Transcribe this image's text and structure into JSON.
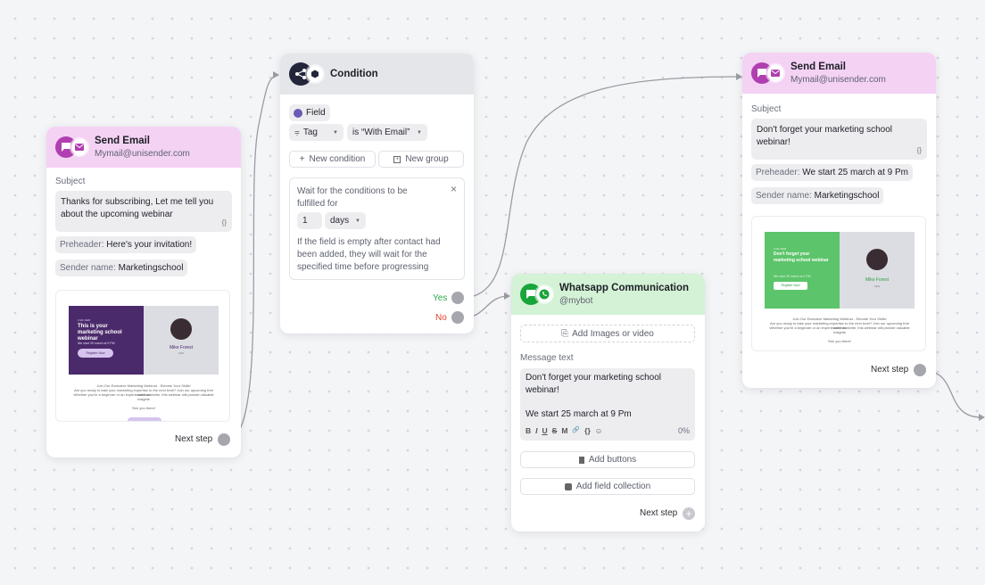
{
  "email_left": {
    "title": "Send Email",
    "sender": "Mymail@unisender.com",
    "subject_label": "Subject",
    "subject": "Thanks for subscribing, Let me tell you about the upcoming webinar",
    "curly": "{}",
    "preheader_key": "Preheader:",
    "preheader_value": "Here's your invitation!",
    "sender_name_key": "Sender name:",
    "sender_name_value": "Marketingschool",
    "preview": {
      "small_top": "LIVE WEB",
      "headline": "This is your marketing school webinar",
      "date": "We start 25 march at 9 PM",
      "cta": "Register Now",
      "person": "Mike Forest",
      "person_role": "CEO",
      "footer_1": "Join Our Exclusive Marketing Webinar - Elevate Your Skills!",
      "footer_2": "Are you ready to take your marketing expertise to the next level? Join our upcoming free webinar",
      "footer_3": "Whether you're a beginner or an experienced marketer, this webinar will provide valuable insights",
      "footer_4": "See you there!"
    },
    "next_step": "Next step"
  },
  "condition": {
    "title": "Condition",
    "field_chip": "Field",
    "tag_select": "Tag",
    "value_select": "is “With Email”",
    "new_condition": "New condition",
    "new_group": "New group",
    "wait_text": "Wait for the conditions to be fulfilled for",
    "wait_number": "1",
    "wait_unit": "days",
    "wait_note": "If the field is empty after contact had been added, they will wait for the specified time before progressing",
    "yes": "Yes",
    "no": "No",
    "close": "×"
  },
  "whatsapp": {
    "title": "Whatsapp Communication",
    "handle": "@mybot",
    "add_media": "Add Images or video",
    "message_label": "Message text",
    "message_line1": "Don't forget your marketing school webinar!",
    "message_line2": "We start 25 march at 9 Pm",
    "counter": "0%",
    "toolbar": [
      "B",
      "I",
      "U",
      "S",
      "M",
      "🔗",
      "{}",
      "☺"
    ],
    "add_buttons": "Add buttons",
    "add_field_collection": "Add field collection",
    "next_step": "Next step"
  },
  "email_right": {
    "title": "Send Email",
    "sender": "Mymail@unisender.com",
    "subject_label": "Subject",
    "subject": "Don't forget your marketing school webinar!",
    "curly": "{}",
    "preheader_key": "Preheader:",
    "preheader_value": "We start 25 march at 9 Pm",
    "sender_name_key": "Sender name:",
    "sender_name_value": "Marketingschool",
    "preview": {
      "small_top": "LIVE WEB",
      "headline": "Don't forget your marketing school webinar",
      "date": "We start 25 march at 9 PM",
      "cta": "Register Now",
      "person": "Mike Forest",
      "person_role": "CEO",
      "footer_1": "Join Our Exclusive Marketing Webinar - Elevate Your Skills!",
      "footer_2": "Are you ready to take your marketing expertise to the next level? Join our upcoming free webinar",
      "footer_3": "Whether you're a beginner or an experienced marketer, this webinar will provide valuable insights",
      "footer_4": "See you there!"
    },
    "next_step": "Next step"
  },
  "colors": {
    "email_head": "#f4d2f4",
    "email_icon": "#b03fb0",
    "condition_head": "#e4e6ea",
    "whatsapp_head": "#d4f2d6",
    "whatsapp_icon": "#1aa53a",
    "yes": "#2fa84f",
    "no": "#e0452d",
    "hero_purple": "#4b2a6b",
    "hero_green": "#5cc46a"
  }
}
